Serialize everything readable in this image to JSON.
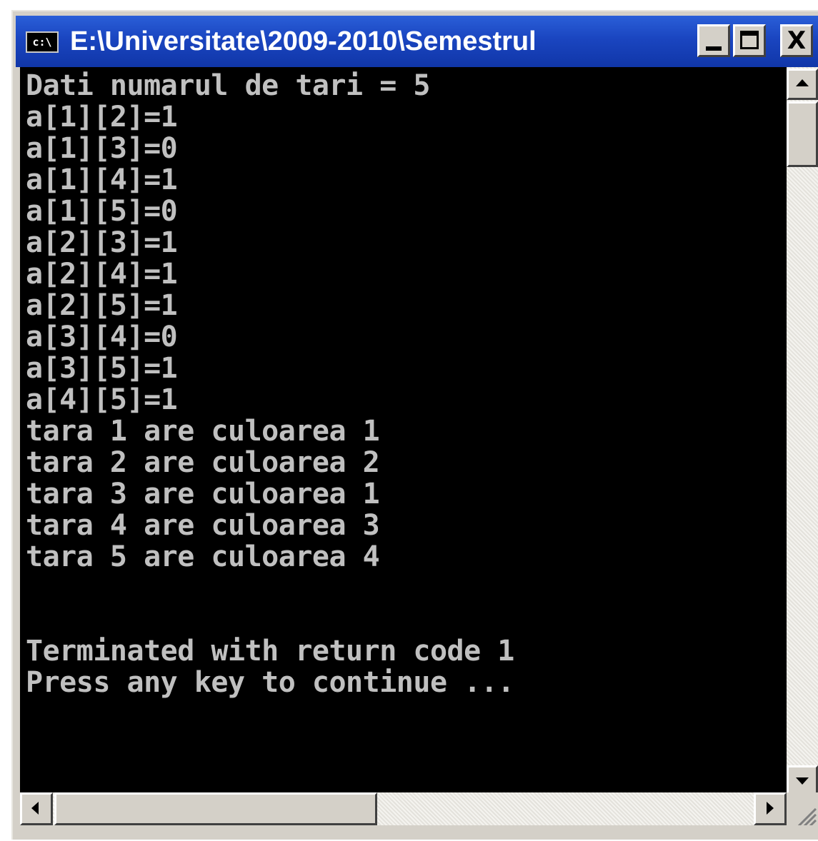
{
  "window": {
    "title": "E:\\Universitate\\2009-2010\\Semestrul",
    "icon_label": "c:\\",
    "controls": {
      "minimize_icon": "minimize-icon",
      "maximize_icon": "maximize-icon",
      "close_icon": "close-icon",
      "close_glyph": "X"
    }
  },
  "console": {
    "lines": [
      "Dati numarul de tari = 5",
      "a[1][2]=1",
      "a[1][3]=0",
      "a[1][4]=1",
      "a[1][5]=0",
      "a[2][3]=1",
      "a[2][4]=1",
      "a[2][5]=1",
      "a[3][4]=0",
      "a[3][5]=1",
      "a[4][5]=1",
      "tara 1 are culoarea 1",
      "tara 2 are culoarea 2",
      "tara 3 are culoarea 1",
      "tara 4 are culoarea 3",
      "tara 5 are culoarea 4",
      "",
      "",
      "Terminated with return code 1",
      "Press any key to continue ..."
    ]
  },
  "colors": {
    "console_background": "#000000",
    "console_text": "#c0c0c0",
    "titlebar": "#1a45c0"
  }
}
